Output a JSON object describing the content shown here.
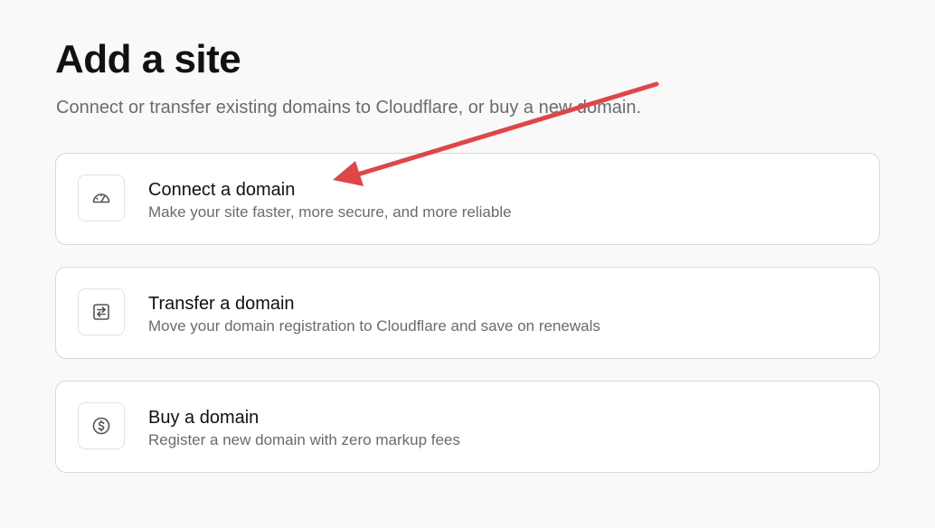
{
  "page": {
    "title": "Add a site",
    "subtitle": "Connect or transfer existing domains to Cloudflare, or buy a new domain."
  },
  "options": [
    {
      "title": "Connect a domain",
      "description": "Make your site faster, more secure, and more reliable",
      "icon": "speedometer-icon"
    },
    {
      "title": "Transfer a domain",
      "description": "Move your domain registration to Cloudflare and save on renewals",
      "icon": "transfer-icon"
    },
    {
      "title": "Buy a domain",
      "description": "Register a new domain with zero markup fees",
      "icon": "dollar-coin-icon"
    }
  ],
  "colors": {
    "background": "#f9f9f9",
    "card_border": "#d9d9d9",
    "title_text": "#111111",
    "muted_text": "#6b6b6b",
    "annotation_arrow": "#e04646"
  }
}
